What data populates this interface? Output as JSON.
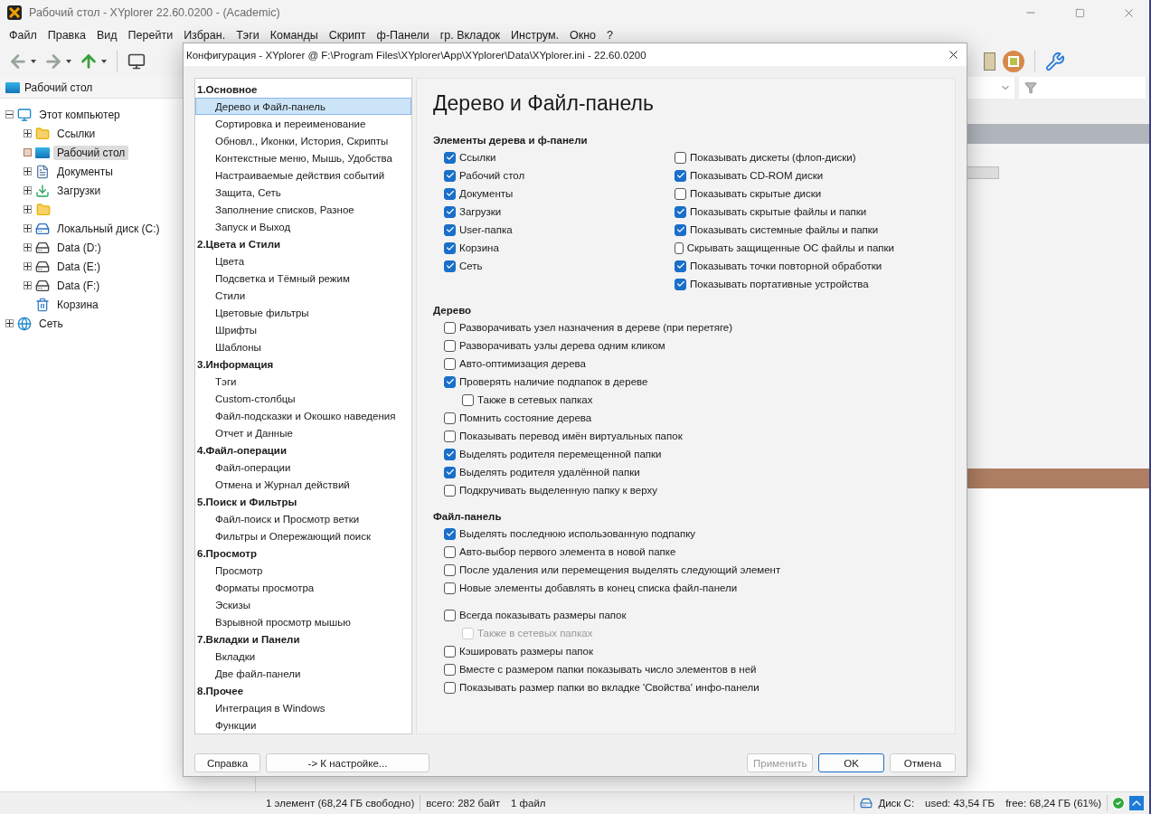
{
  "window": {
    "title": "Рабочий стол - XYplorer 22.60.0200 - (Academic)"
  },
  "menu": [
    "Файл",
    "Правка",
    "Вид",
    "Перейти",
    "Избран.",
    "Тэги",
    "Команды",
    "Скрипт",
    "ф-Панели",
    "гр. Вкладок",
    "Инструм.",
    "Окно",
    "?"
  ],
  "address": {
    "label": "Рабочий стол"
  },
  "tree": [
    {
      "label": "Этот компьютер",
      "kind": "computer",
      "expanded": true,
      "selected": false,
      "children": [
        {
          "label": "Ссылки",
          "kind": "folder",
          "expanded": false,
          "selected": false
        },
        {
          "label": "Рабочий стол",
          "kind": "desktop",
          "selected": true
        },
        {
          "label": "Документы",
          "kind": "documents",
          "expanded": false,
          "selected": false
        },
        {
          "label": "Загрузки",
          "kind": "download",
          "expanded": false,
          "selected": false
        },
        {
          "kind": "folder",
          "expanded": false,
          "selected": false
        },
        {
          "label": "Локальный диск (C:)",
          "kind": "system-drive",
          "expanded": false,
          "selected": false
        },
        {
          "label": "Data (D:)",
          "kind": "drive",
          "expanded": false,
          "selected": false
        },
        {
          "label": "Data (E:)",
          "kind": "drive",
          "expanded": false,
          "selected": false
        },
        {
          "label": "Data (F:)",
          "kind": "drive",
          "expanded": false,
          "selected": false
        },
        {
          "label": "Корзина",
          "kind": "recycle",
          "selected": false
        }
      ]
    },
    {
      "label": "Сеть",
      "kind": "network",
      "expanded": false,
      "selected": false
    }
  ],
  "dialog": {
    "title": "Конфигурация - XYplorer @ F:\\Program Files\\XYplorer\\App\\XYplorer\\Data\\XYplorer.ini - 22.60.0200",
    "nav": [
      {
        "heading": "1.Основное",
        "items": [
          {
            "label": "Дерево и Файл-панель",
            "selected": true
          },
          {
            "label": "Сортировка и переименование",
            "selected": false
          },
          {
            "label": "Обновл., Иконки, История, Скрипты",
            "selected": false
          },
          {
            "label": "Контекстные меню, Мышь, Удобства",
            "selected": false
          },
          {
            "label": "Настраиваемые действия событий",
            "selected": false
          },
          {
            "label": "Защита, Сеть",
            "selected": false
          },
          {
            "label": "Заполнение списков, Разное",
            "selected": false
          },
          {
            "label": "Запуск и Выход",
            "selected": false
          }
        ]
      },
      {
        "heading": "2.Цвета и Стили",
        "items": [
          {
            "label": "Цвета",
            "selected": false
          },
          {
            "label": "Подсветка и Тёмный режим",
            "selected": false
          },
          {
            "label": "Стили",
            "selected": false
          },
          {
            "label": "Цветовые фильтры",
            "selected": false
          },
          {
            "label": "Шрифты",
            "selected": false
          },
          {
            "label": "Шаблоны",
            "selected": false
          }
        ]
      },
      {
        "heading": "3.Информация",
        "items": [
          {
            "label": "Тэги",
            "selected": false
          },
          {
            "label": "Custom-столбцы",
            "selected": false
          },
          {
            "label": "Файл-подсказки и Окошко наведения",
            "selected": false
          },
          {
            "label": "Отчет и Данные",
            "selected": false
          }
        ]
      },
      {
        "heading": "4.Файл-операции",
        "items": [
          {
            "label": "Файл-операции",
            "selected": false
          },
          {
            "label": "Отмена и Журнал действий",
            "selected": false
          }
        ]
      },
      {
        "heading": "5.Поиск и Фильтры",
        "items": [
          {
            "label": "Файл-поиск и Просмотр ветки",
            "selected": false
          },
          {
            "label": "Фильтры и Опережающий поиск",
            "selected": false
          }
        ]
      },
      {
        "heading": "6.Просмотр",
        "items": [
          {
            "label": "Просмотр",
            "selected": false
          },
          {
            "label": "Форматы просмотра",
            "selected": false
          },
          {
            "label": "Эскизы",
            "selected": false
          },
          {
            "label": "Взрывной просмотр мышью",
            "selected": false
          }
        ]
      },
      {
        "heading": "7.Вкладки и Панели",
        "items": [
          {
            "label": "Вкладки",
            "selected": false
          },
          {
            "label": "Две файл-панели",
            "selected": false
          }
        ]
      },
      {
        "heading": "8.Прочее",
        "items": [
          {
            "label": "Интеграция в Windows",
            "selected": false
          },
          {
            "label": "Функции",
            "selected": false
          }
        ]
      }
    ],
    "page_title": "Дерево и Файл-панель",
    "sections": [
      {
        "heading": "Элементы дерева и ф-панели",
        "columns": [
          {
            "items": [
              {
                "label": "Ссылки",
                "checked": true,
                "disabled": false
              },
              {
                "label": "Рабочий стол",
                "checked": true,
                "disabled": false
              },
              {
                "label": "Документы",
                "checked": true,
                "disabled": false
              },
              {
                "label": "Загрузки",
                "checked": true,
                "disabled": false
              },
              {
                "label": "User-папка",
                "checked": true,
                "disabled": false
              },
              {
                "label": "Корзина",
                "checked": true,
                "disabled": false
              },
              {
                "label": "Сеть",
                "checked": true,
                "disabled": false
              }
            ]
          },
          {
            "items": [
              {
                "label": "Показывать дискеты (флоп-диски)",
                "checked": false,
                "disabled": false
              },
              {
                "label": "Показывать CD-ROM диски",
                "checked": true,
                "disabled": false
              },
              {
                "label": "Показывать скрытые диски",
                "checked": false,
                "disabled": false
              },
              {
                "label": "Показывать скрытые файлы и папки",
                "checked": true,
                "disabled": false
              },
              {
                "label": "Показывать системные файлы и папки",
                "checked": true,
                "disabled": false
              },
              {
                "label": "Скрывать защищенные ОС файлы и папки",
                "checked": false,
                "disabled": false
              },
              {
                "label": "Показывать точки повторной обработки",
                "checked": true,
                "disabled": false
              },
              {
                "label": "Показывать портативные устройства",
                "checked": true,
                "disabled": false
              }
            ]
          }
        ]
      },
      {
        "heading": "Дерево",
        "columns": [
          {
            "items": [
              {
                "label": "Разворачивать узел назначения в дереве (при перетяге)",
                "checked": false,
                "disabled": false
              },
              {
                "label": "Разворачивать узлы дерева одним кликом",
                "checked": false,
                "disabled": false
              },
              {
                "label": "Авто-оптимизация дерева",
                "checked": false,
                "disabled": false
              },
              {
                "label": "Проверять наличие подпапок в дереве",
                "checked": true,
                "disabled": false,
                "children": [
                  {
                    "label": "Также в сетевых папках",
                    "checked": false,
                    "disabled": false
                  }
                ]
              },
              {
                "label": "Помнить состояние дерева",
                "checked": false,
                "disabled": false
              },
              {
                "label": "Показывать перевод имён виртуальных папок",
                "checked": false,
                "disabled": false
              },
              {
                "label": "Выделять родителя перемещенной папки",
                "checked": true,
                "disabled": false
              },
              {
                "label": "Выделять родителя удалённой папки",
                "checked": true,
                "disabled": false
              },
              {
                "label": "Подкручивать выделенную папку к верху",
                "checked": false,
                "disabled": false
              }
            ]
          }
        ]
      },
      {
        "heading": "Файл-панель",
        "columns": [
          {
            "items": [
              {
                "label": "Выделять последнюю использованную подпапку",
                "checked": true,
                "disabled": false
              },
              {
                "label": "Авто-выбор первого элемента в новой папке",
                "checked": false,
                "disabled": false
              },
              {
                "label": "После удаления или перемещения выделять следующий элемент",
                "checked": false,
                "disabled": false
              },
              {
                "label": "Новые элементы добавлять в конец списка файл-панели",
                "checked": false,
                "disabled": false
              }
            ]
          }
        ]
      },
      {
        "columns": [
          {
            "items": [
              {
                "label": "Всегда показывать размеры папок",
                "checked": false,
                "disabled": false,
                "children": [
                  {
                    "label": "Также в сетевых папках",
                    "checked": false,
                    "disabled": true
                  }
                ]
              },
              {
                "label": "Кэшировать размеры папок",
                "checked": false,
                "disabled": false
              },
              {
                "label": "Вместе с размером папки показывать число элементов в ней",
                "checked": false,
                "disabled": false
              },
              {
                "label": "Показывать размер папки во вкладке 'Свойства' инфо-панели",
                "checked": false,
                "disabled": false
              }
            ]
          }
        ]
      }
    ],
    "buttons": [
      {
        "label": "Справка",
        "kind": "plain",
        "disabled": false
      },
      {
        "label": "-> К настройке...",
        "kind": "wide",
        "disabled": false
      },
      {
        "label": "Применить",
        "kind": "plain",
        "disabled": true
      },
      {
        "label": "OK",
        "kind": "default",
        "disabled": false
      },
      {
        "label": "Отмена",
        "kind": "plain",
        "disabled": false
      }
    ]
  },
  "status_bar": {
    "items": "1 элемент (68,24 ГБ свободно)",
    "total": "всего: 282 байт",
    "files": "1 файл",
    "disk": "Диск C:",
    "used": "used: 43,54 ГБ",
    "free": "free: 68,24 ГБ (61%)"
  }
}
